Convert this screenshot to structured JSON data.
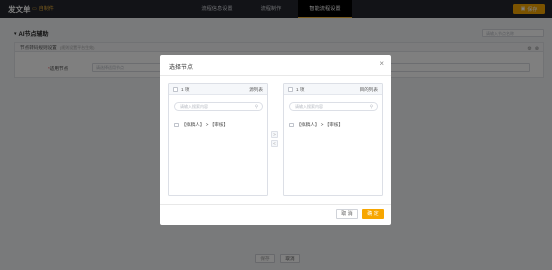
{
  "header": {
    "app_title": "发文单",
    "app_sub_icon": "document-icon",
    "app_sub_label": "自制件",
    "nav": [
      {
        "label": "流程信息设置",
        "active": false
      },
      {
        "label": "流程制作",
        "active": false
      },
      {
        "label": "智能流程设置",
        "active": true
      }
    ],
    "save_label": "保存"
  },
  "page": {
    "section_title": "AI节点辅助",
    "search_placeholder": "请输入节点名称",
    "card_title": "节点转码规则设置",
    "card_hint": "(规则设置平台生效)",
    "field_label": "*适用节点",
    "field_required_mark": "*",
    "field_label_text": "适用节点",
    "field_placeholder": "请选择适用节点",
    "prev_label": "保存",
    "cancel_label": "取消"
  },
  "modal": {
    "title": "选择节点",
    "left": {
      "count": "1 项",
      "name": "源列表",
      "search_placeholder": "请输入搜索内容",
      "item": "【拟稿人】 > 【审核】"
    },
    "right": {
      "count": "1 项",
      "name": "目的列表",
      "search_placeholder": "请输入搜索内容",
      "item": "【拟稿人】 > 【审核】"
    },
    "to_right_label": ">",
    "to_left_label": "<",
    "cancel_label": "取 消",
    "ok_label": "确 定"
  },
  "colors": {
    "accent": "#f7a600",
    "header_bg": "#24272e"
  }
}
